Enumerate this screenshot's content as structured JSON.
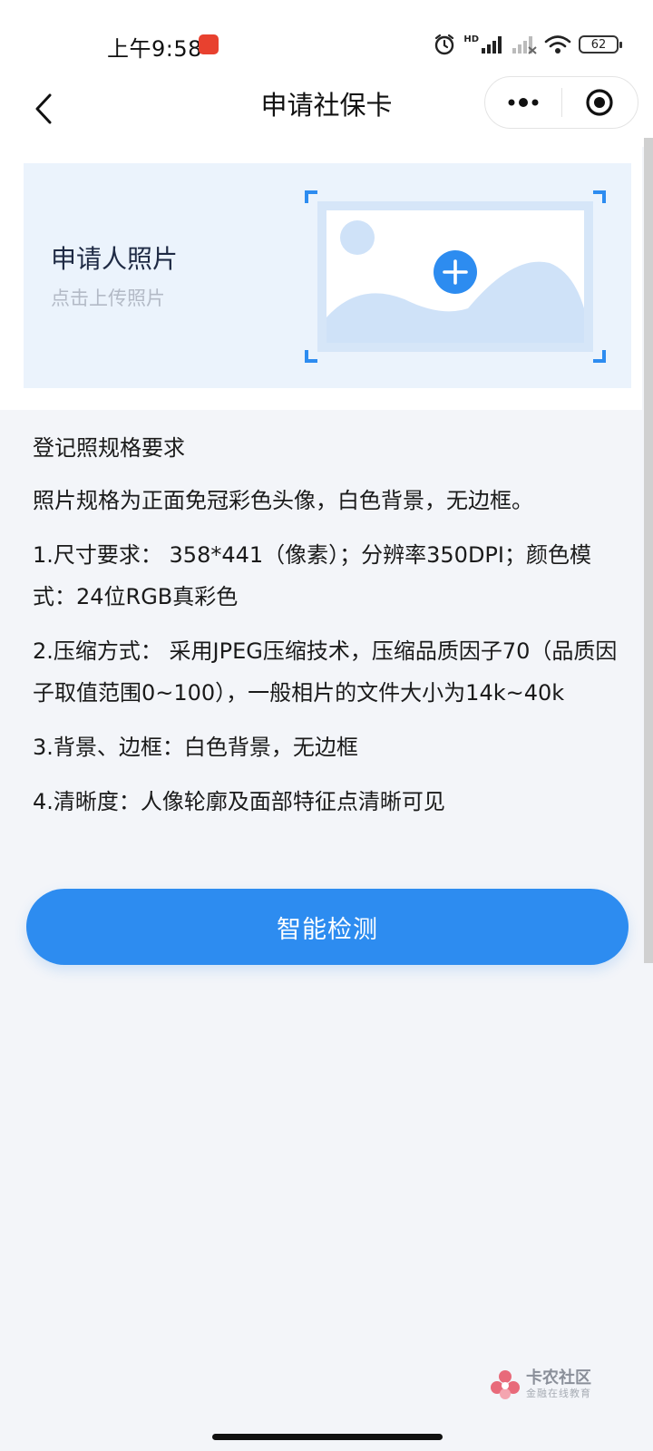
{
  "status_bar": {
    "time": "上午9:58",
    "network_label": "HD",
    "battery": "62"
  },
  "nav": {
    "title": "申请社保卡"
  },
  "upload": {
    "title": "申请人照片",
    "hint": "点击上传照片"
  },
  "spec": {
    "title": "登记照规格要求",
    "paragraphs": [
      "照片规格为正面免冠彩色头像，白色背景，无边框。",
      "1.尺寸要求： 358*441（像素）；分辨率350DPI；颜色模式：24位RGB真彩色",
      "2.压缩方式： 采用JPEG压缩技术，压缩品质因子70（品质因子取值范围0~100），一般相片的文件大小为14k~40k",
      "3.背景、边框：白色背景，无边框",
      "4.清晰度：人像轮廓及面部特征点清晰可见"
    ]
  },
  "actions": {
    "check_label": "智能检测"
  },
  "watermark": {
    "main": "卡农社区",
    "sub": "金融在线教育"
  },
  "colors": {
    "accent": "#2d8cf0",
    "card_bg": "#ebf3fc",
    "page_bg": "#f3f5f9"
  },
  "icons": [
    "alarm-icon",
    "signal-icon",
    "wifi-icon",
    "battery-icon",
    "back-arrow-icon",
    "more-dots-icon",
    "target-icon",
    "plus-icon",
    "image-placeholder-icon"
  ]
}
